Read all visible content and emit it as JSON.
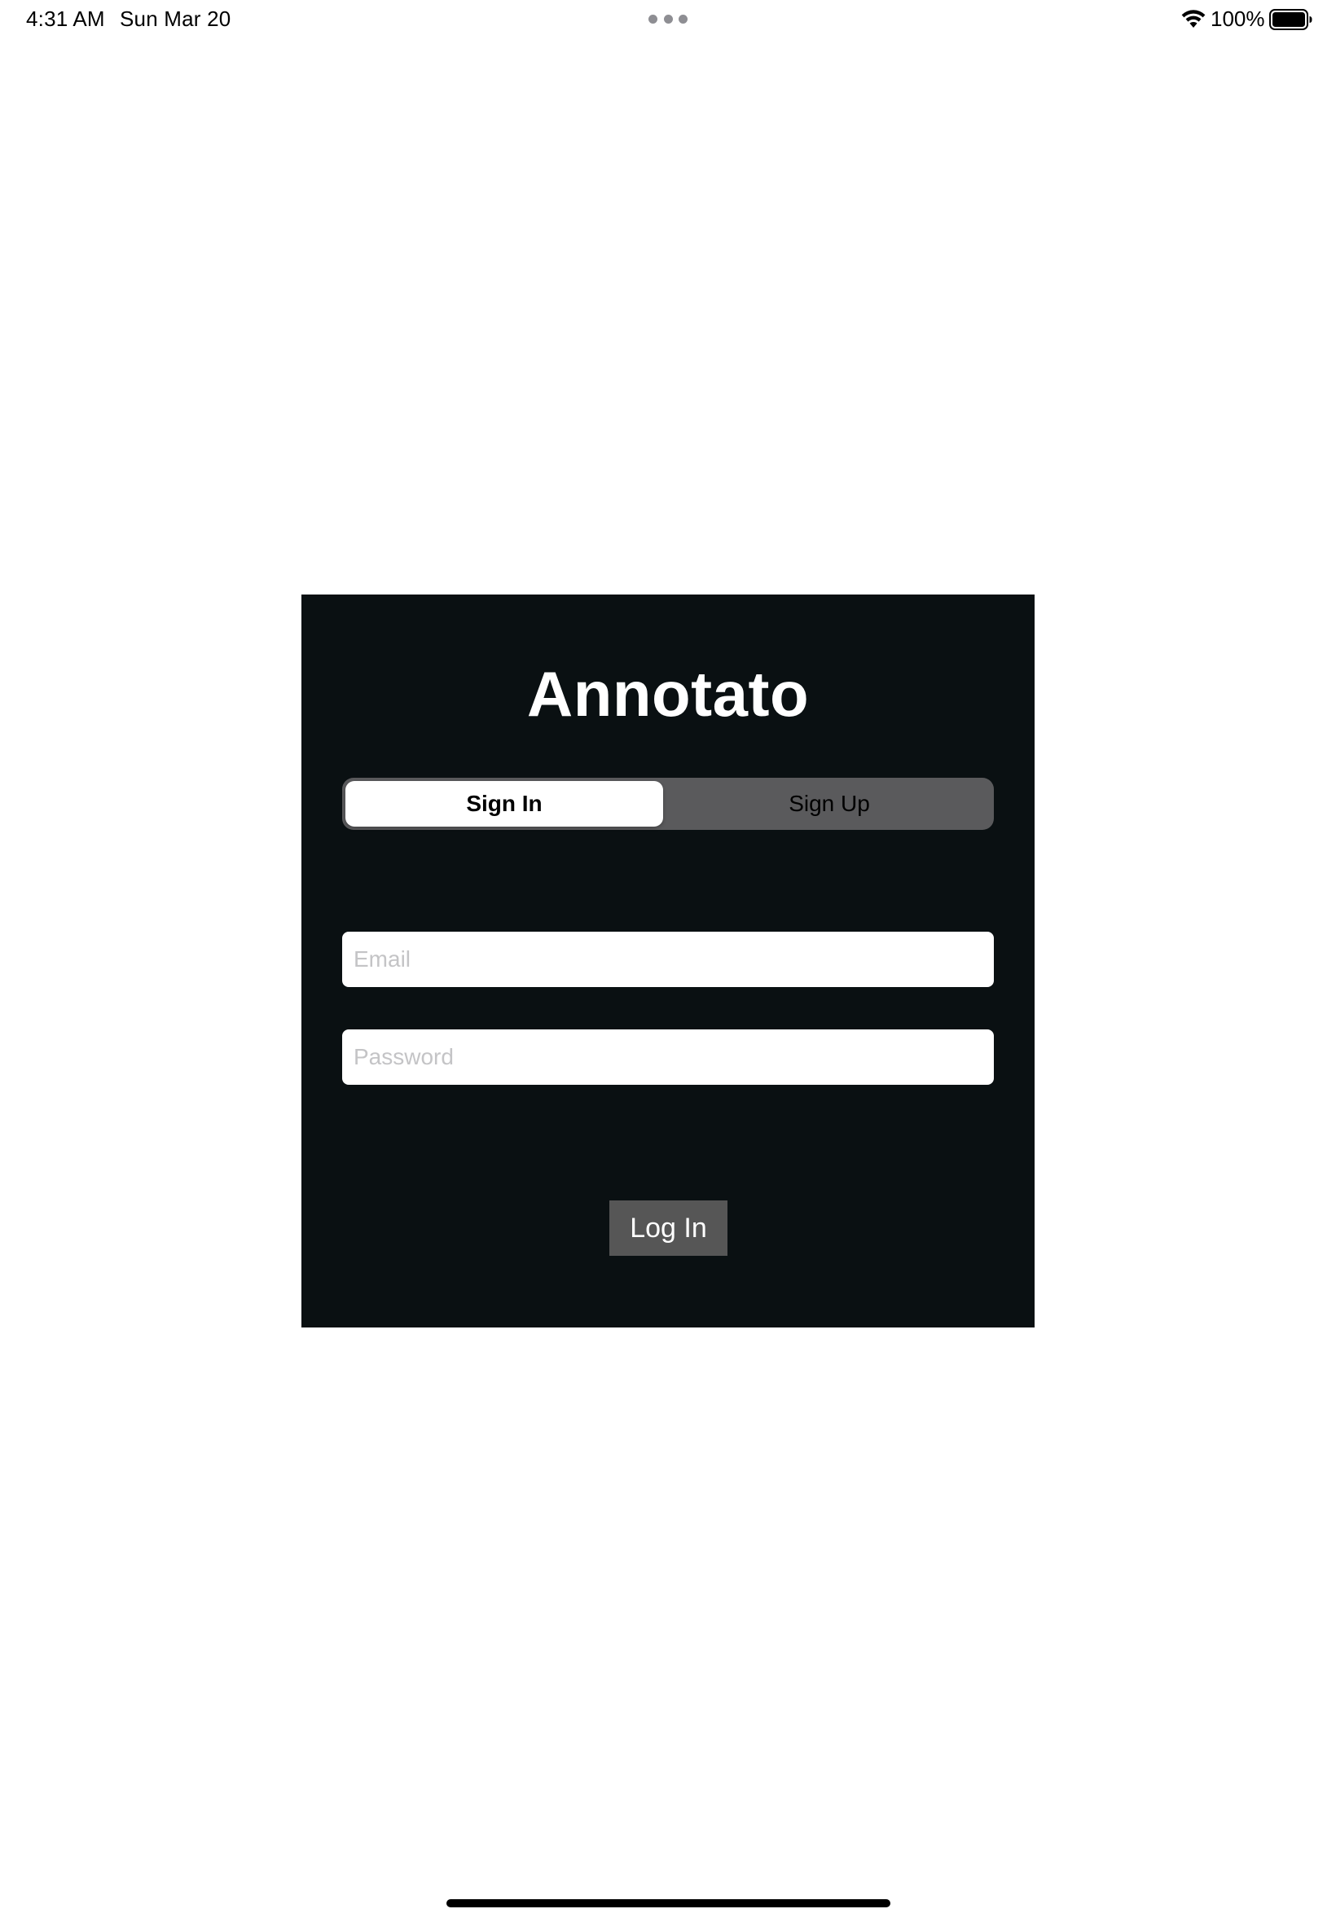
{
  "status_bar": {
    "time": "4:31 AM",
    "date": "Sun Mar 20",
    "battery_percent": "100%",
    "icons": [
      "wifi-icon",
      "battery-icon",
      "multitask-dots-icon"
    ]
  },
  "auth": {
    "title": "Annotato",
    "segments": [
      {
        "label": "Sign In",
        "selected": true
      },
      {
        "label": "Sign Up",
        "selected": false
      }
    ],
    "email": {
      "value": "",
      "placeholder": "Email"
    },
    "password": {
      "value": "",
      "placeholder": "Password"
    },
    "login_label": "Log In"
  },
  "colors": {
    "card_background": "#0a1012",
    "segment_track": "#5a5a5c",
    "button_background": "#565656",
    "page_background": "#ffffff"
  }
}
